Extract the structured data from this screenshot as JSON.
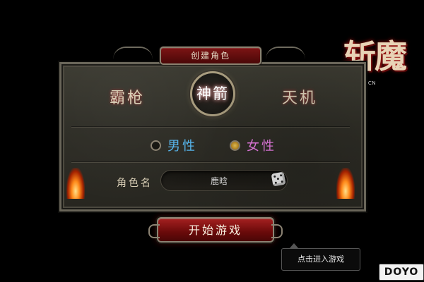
{
  "dialog": {
    "title": "创建角色"
  },
  "classes": {
    "left": "霸枪",
    "selected": "神箭",
    "right": "天机"
  },
  "gender": {
    "male": "男性",
    "female": "女性",
    "selected": "female"
  },
  "name": {
    "label": "角色名",
    "value": "鹿晗"
  },
  "start_button": "开始游戏",
  "tooltip": "点击进入游戏",
  "logo": {
    "text": "斩魔",
    "url": "ZM.GAME2.CN"
  },
  "watermark": "DOYO",
  "colors": {
    "male": "#56b6ee",
    "female": "#ea7de6",
    "accent_red": "#7c1414"
  }
}
